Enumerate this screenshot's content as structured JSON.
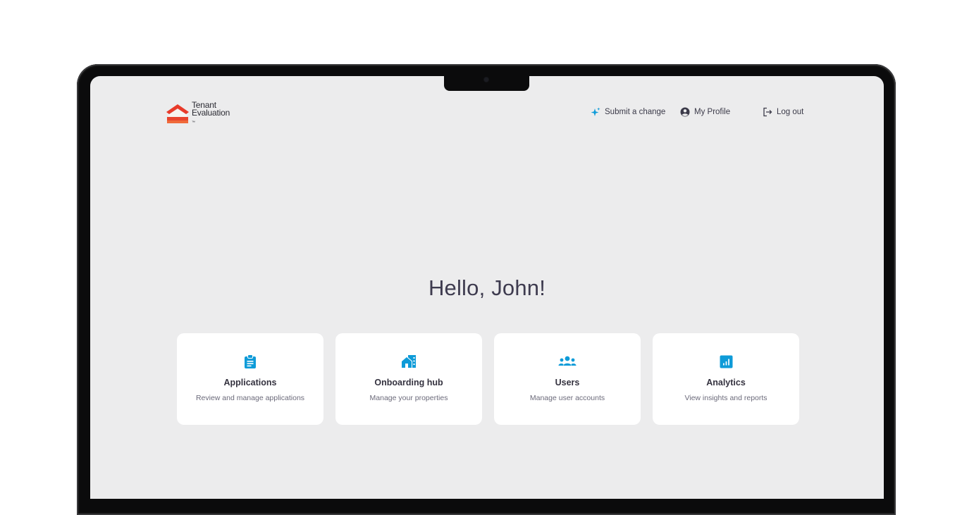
{
  "brand": {
    "name_line1": "Tenant",
    "name_line2": "Evaluation",
    "trademark": "™",
    "logo_colors": [
      "#e83a2a",
      "#f06a3a"
    ]
  },
  "nav": {
    "submit_change": "Submit a change",
    "my_profile": "My Profile",
    "log_out": "Log out",
    "icons": {
      "submit_change": "sparkle-icon",
      "my_profile": "user-circle-icon",
      "log_out": "logout-icon"
    }
  },
  "greeting": "Hello, John!",
  "cards": [
    {
      "title": "Applications",
      "description": "Review and manage applications",
      "icon": "clipboard-icon"
    },
    {
      "title": "Onboarding hub",
      "description": "Manage your properties",
      "icon": "house-building-icon"
    },
    {
      "title": "Users",
      "description": "Manage user accounts",
      "icon": "users-group-icon"
    },
    {
      "title": "Analytics",
      "description": "View insights and reports",
      "icon": "bar-chart-icon"
    }
  ],
  "colors": {
    "accent": "#0e9bd8",
    "background": "#ececed",
    "text": "#3e3b4f"
  }
}
